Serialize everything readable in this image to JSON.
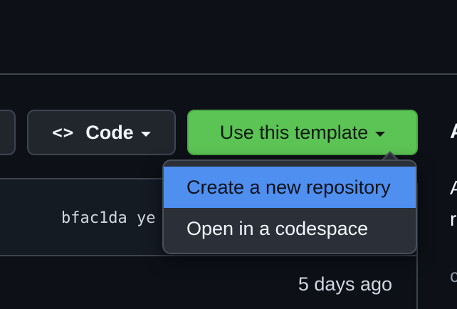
{
  "toolbar": {
    "code_button": {
      "icon": "code-brackets-icon",
      "icon_glyph": "<>",
      "label": "Code"
    },
    "template_button": {
      "label": "Use this template"
    }
  },
  "template_menu": {
    "items": [
      {
        "label": "Create a new repository",
        "highlighted": true
      },
      {
        "label": "Open in a codespace",
        "highlighted": false
      }
    ]
  },
  "file_table": {
    "latest_commit_hash": "bfac1da",
    "latest_commit_time_fragment": "ye",
    "row_time": "5 days ago"
  },
  "sidebar_partial": {
    "glyph_1": "A",
    "glyph_2": "A",
    "glyph_3": "r",
    "glyph_4": "c"
  },
  "colors": {
    "background": "#0d1117",
    "template_button": "#5cc355",
    "menu_highlight": "#4e8ff0",
    "border": "#3d444d"
  }
}
